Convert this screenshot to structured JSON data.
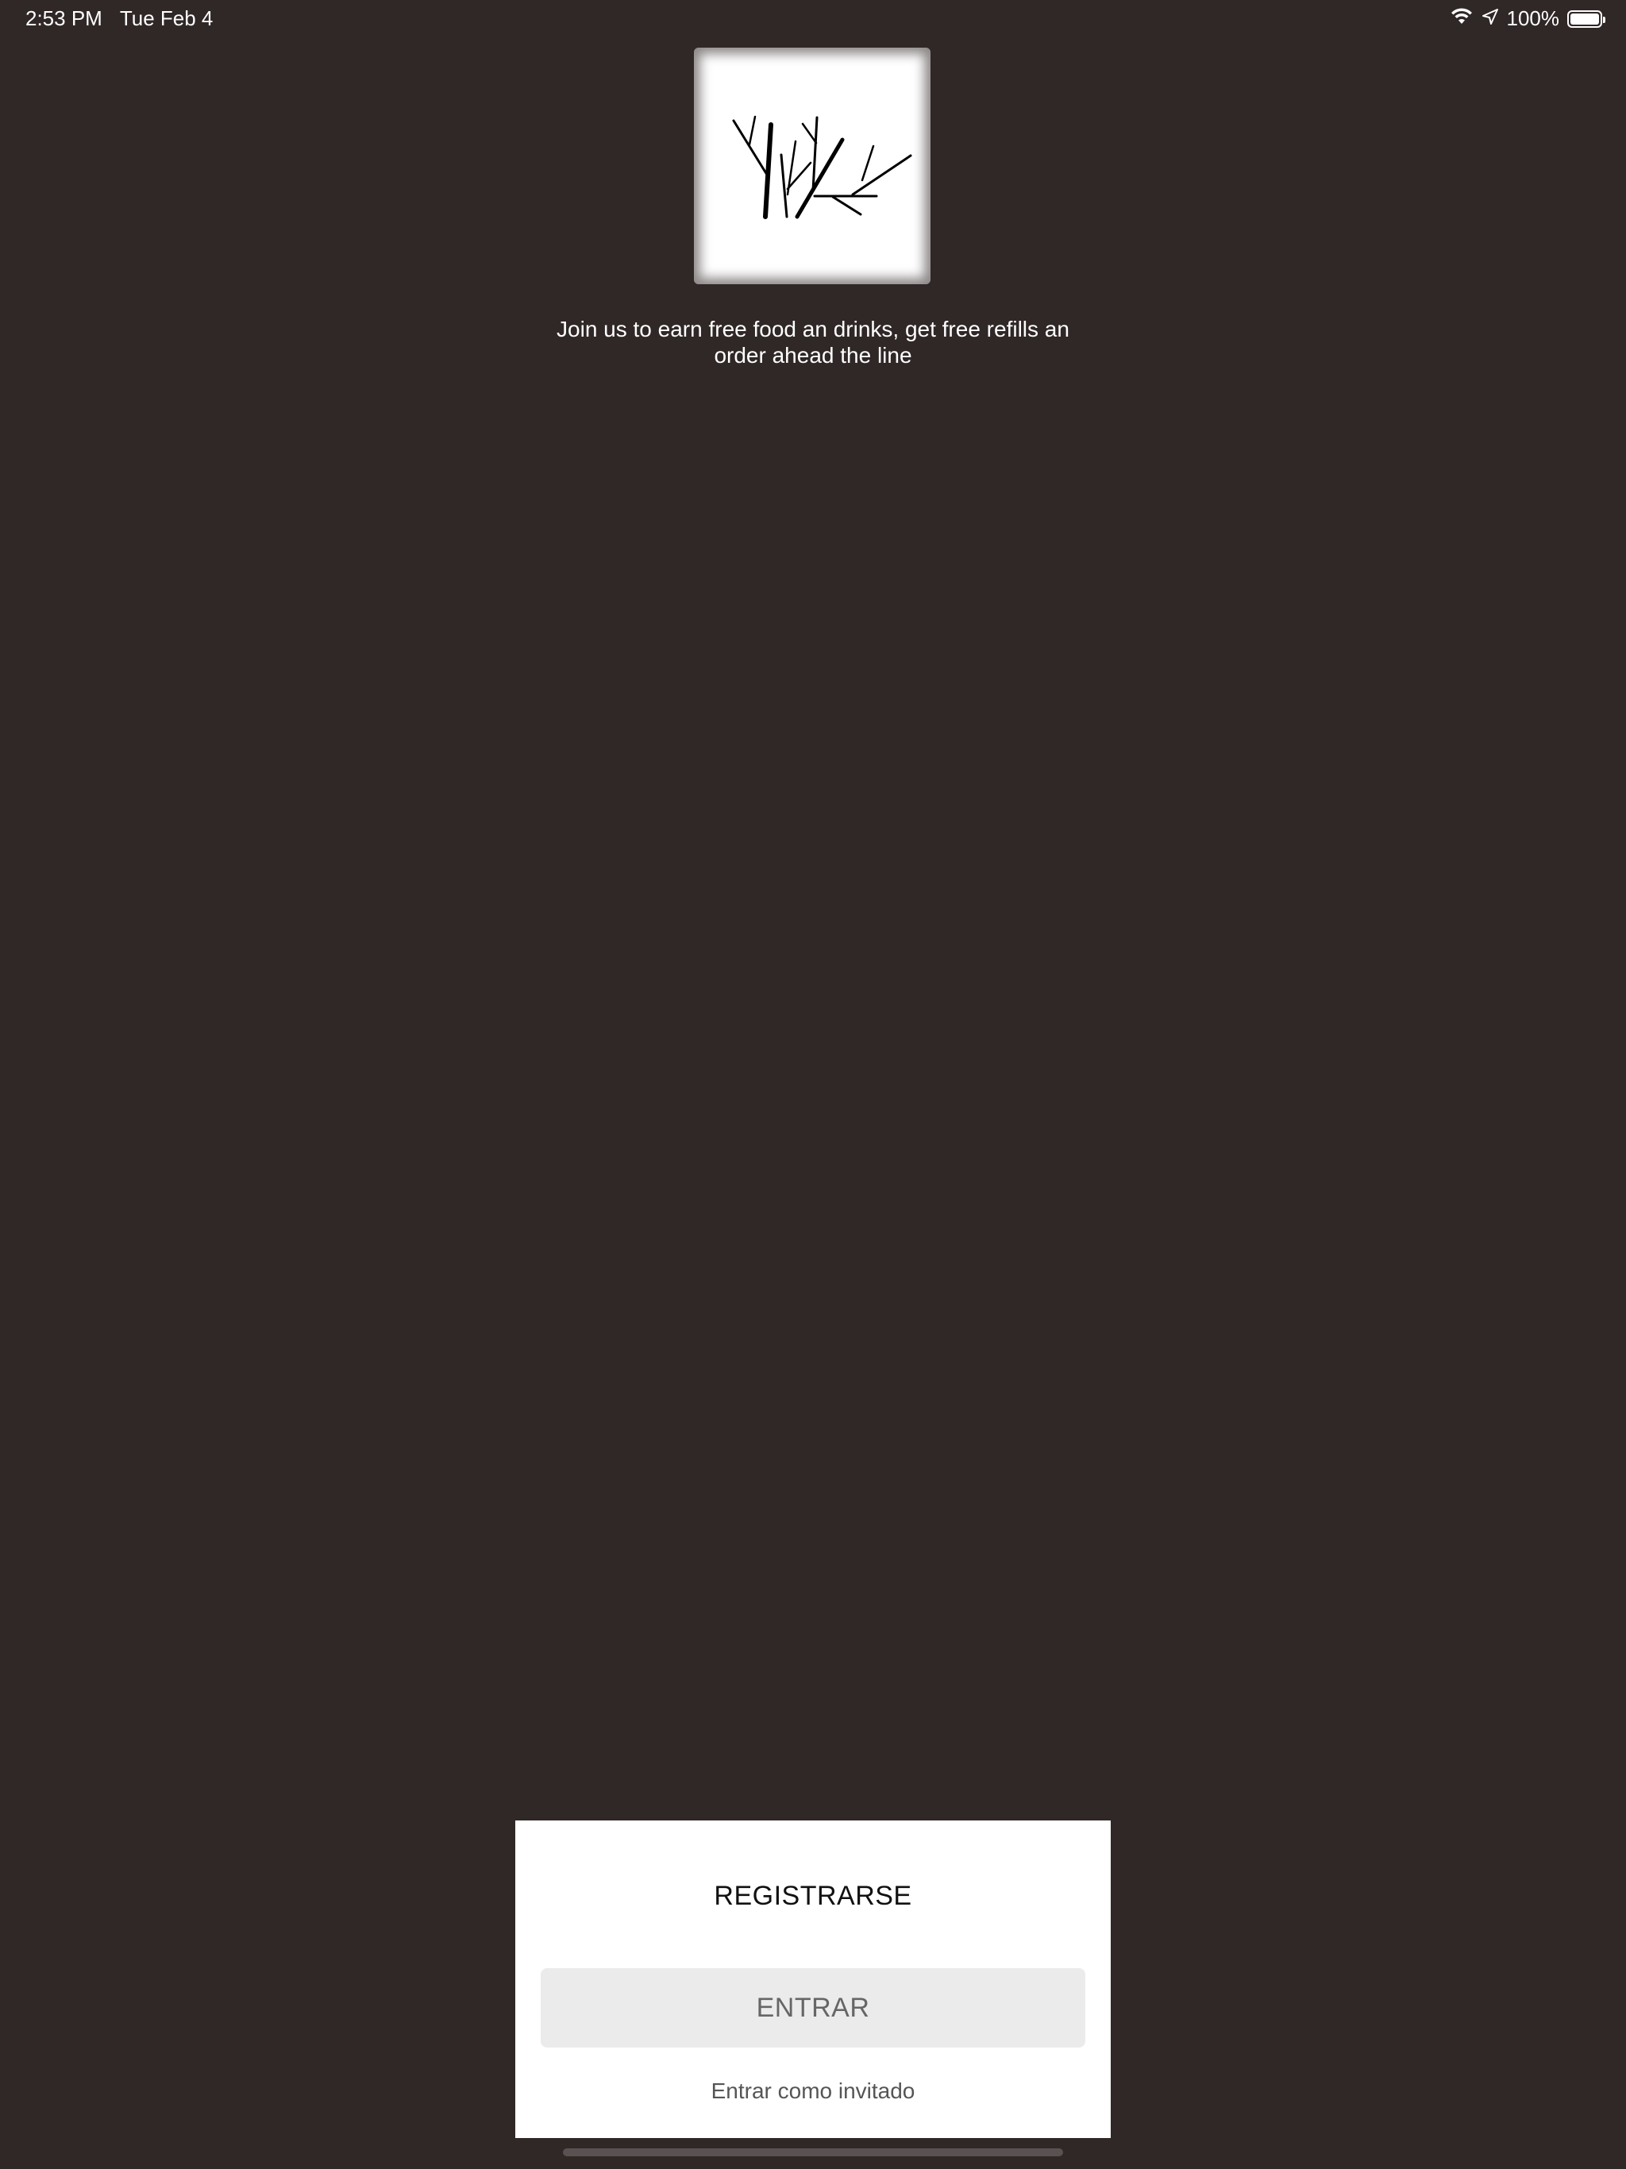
{
  "status_bar": {
    "time": "2:53 PM",
    "date": "Tue Feb 4",
    "battery_percent": "100%",
    "battery_level": 1.0,
    "icons": [
      "wifi-icon",
      "location-arrow-icon",
      "battery-icon"
    ]
  },
  "logo": {
    "icon": "branches-logo-icon"
  },
  "tagline": {
    "text": "Join us to earn free food an drinks, get free refills an order ahead the line"
  },
  "auth": {
    "register_label": "REGISTRARSE",
    "login_label": "ENTRAR",
    "guest_label": "Entrar como invitado"
  },
  "colors": {
    "background": "#302727",
    "card": "#ffffff",
    "login_button_bg": "#ebebeb",
    "login_button_text": "#666666"
  }
}
